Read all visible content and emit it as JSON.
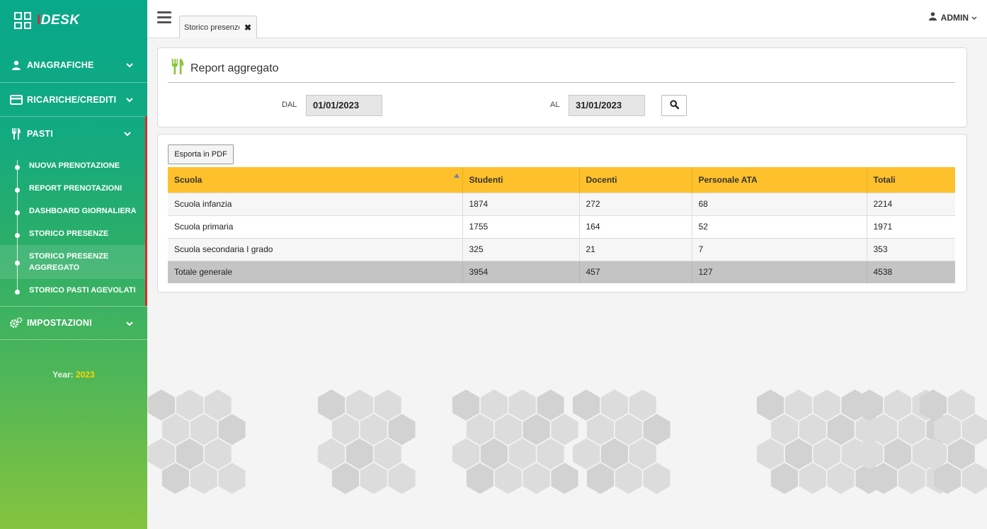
{
  "sidebar": {
    "logo_text": "IDESK",
    "items": [
      {
        "label": "ANAGRAFICHE"
      },
      {
        "label": "RICARICHE/CREDITI"
      },
      {
        "label": "PASTI"
      },
      {
        "label": "IMPOSTAZIONI"
      }
    ],
    "submenu": [
      {
        "label": "NUOVA PRENOTAZIONE"
      },
      {
        "label": "REPORT PRENOTAZIONI"
      },
      {
        "label": "DASHBOARD GIORNALIERA"
      },
      {
        "label": "STORICO PRESENZE"
      },
      {
        "label": "STORICO PRESENZE AGGREGATO"
      },
      {
        "label": "STORICO PASTI AGEVOLATI"
      }
    ],
    "year_label": "Year:",
    "year_value": "2023"
  },
  "topbar": {
    "tab_label": "Storico presenze aggregato",
    "user_label": "ADMIN"
  },
  "filter_panel": {
    "title": "Report aggregato",
    "from_label": "DAL",
    "from_value": "01/01/2023",
    "to_label": "AL",
    "to_value": "31/01/2023"
  },
  "report": {
    "export_label": "Esporta in PDF",
    "columns": [
      "Scuola",
      "Studenti",
      "Docenti",
      "Personale ATA",
      "Totali"
    ],
    "rows": [
      [
        "Scuola infanzia",
        "1874",
        "272",
        "68",
        "2214"
      ],
      [
        "Scuola primaria",
        "1755",
        "164",
        "52",
        "1971"
      ],
      [
        "Scuola secondaria I grado",
        "325",
        "21",
        "7",
        "353"
      ]
    ],
    "total": [
      "Totale generale",
      "3954",
      "457",
      "127",
      "4538"
    ]
  },
  "colors": {
    "sidebar_top": "#08a88a",
    "sidebar_bottom": "#85c43e",
    "table_header": "#ffc12b",
    "active_marker": "#d32f2f"
  }
}
